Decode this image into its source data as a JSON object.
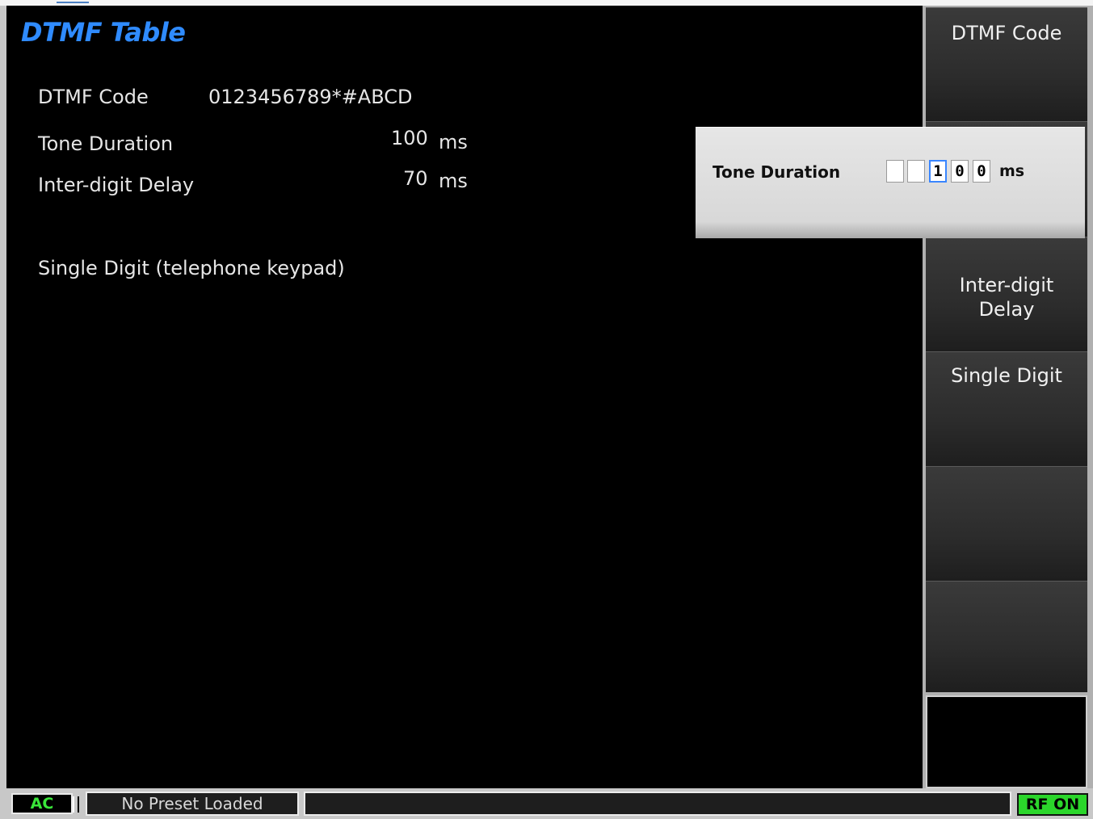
{
  "title": "DTMF Table",
  "settings": {
    "dtmf_code": {
      "label": "DTMF Code",
      "value": "0123456789*#ABCD"
    },
    "tone_duration": {
      "label": "Tone Duration",
      "value": "100",
      "unit": "ms"
    },
    "inter_digit_delay": {
      "label": "Inter-digit Delay",
      "value": "70",
      "unit": "ms"
    },
    "single_digit": {
      "label": "Single Digit (telephone keypad)"
    }
  },
  "softkeys": [
    {
      "label": "DTMF Code"
    },
    {
      "label": "Inter-digit\nDelay"
    },
    {
      "label": "Single Digit"
    }
  ],
  "popup": {
    "label": "Tone Duration",
    "digits": [
      "",
      "",
      "1",
      "0",
      "0"
    ],
    "unit": "ms"
  },
  "status": {
    "coupling": "AC",
    "preset": "No Preset Loaded",
    "message": "",
    "rf": "RF ON"
  },
  "colors": {
    "title": "#2f8bff",
    "rf_on": "#2bd62b",
    "ac_text": "#3ae63a",
    "cursor": "#3a86ff"
  }
}
